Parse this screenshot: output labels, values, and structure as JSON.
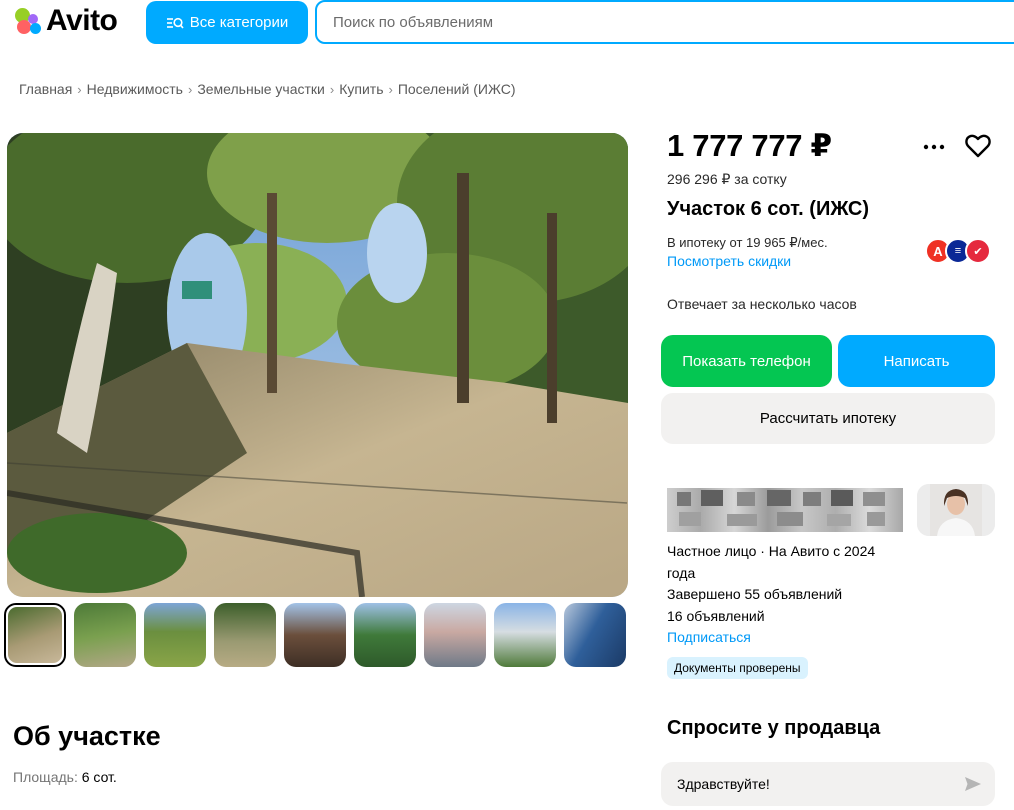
{
  "header": {
    "logo_text": "Avito",
    "categories_button": "Все категории",
    "search_placeholder": "Поиск по объявлениям"
  },
  "breadcrumb": [
    "Главная",
    "Недвижимость",
    "Земельные участки",
    "Купить",
    "Поселений (ИЖС)"
  ],
  "listing": {
    "price": "1 777 777 ₽",
    "price_per_sotka": "296 296 ₽ за сотку",
    "title": "Участок 6 сот. (ИЖС)",
    "mortgage_text": "В ипотеку от 19 965 ₽/мес.",
    "discounts_link": "Посмотреть скидки",
    "bank_logos": [
      "alfa-bank-icon",
      "vtb-icon",
      "sovcombank-icon"
    ],
    "response_time": "Отвечает за несколько часов",
    "thumbnail_count": 9,
    "active_thumbnail": 1
  },
  "buttons": {
    "show_phone": "Показать телефон",
    "write": "Написать",
    "calc_mortgage": "Рассчитать ипотеку"
  },
  "seller": {
    "type_since": "Частное лицо · На Авито с 2024 года",
    "completed": "Завершено 55 объявлений",
    "active": "16 объявлений",
    "subscribe": "Подписаться",
    "badge": "Документы проверены"
  },
  "about": {
    "title": "Об участке",
    "area_label": "Площадь:",
    "area_value": "6 сот."
  },
  "ask": {
    "title": "Спросите у продавца",
    "message": "Здравствуйте!"
  },
  "colors": {
    "accent_blue": "#00aaff",
    "green": "#04c652",
    "link": "#0099f7",
    "grey_bg": "#f2f1f0"
  }
}
